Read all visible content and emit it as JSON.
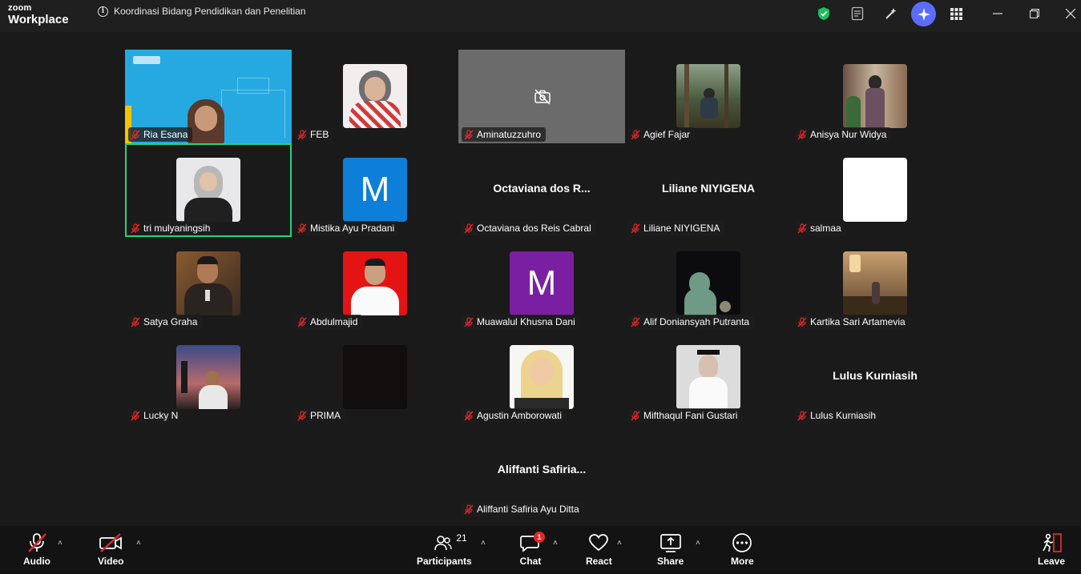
{
  "app": {
    "brand_line1": "zoom",
    "brand_line2": "Workplace"
  },
  "meeting": {
    "title": "Koordinasi Bidang Pendidikan dan Penelitian"
  },
  "participants": [
    {
      "name": "Ria Esana",
      "display_text": ""
    },
    {
      "name": "FEB",
      "display_text": ""
    },
    {
      "name": "Aminatuzzuhro",
      "display_text": ""
    },
    {
      "name": "Agief Fajar",
      "display_text": ""
    },
    {
      "name": "Anisya Nur Widya",
      "display_text": ""
    },
    {
      "name": "tri mulyaningsih",
      "display_text": ""
    },
    {
      "name": "Mistika Ayu Pradani",
      "display_text": "M"
    },
    {
      "name": "Octaviana dos Reis Cabral",
      "display_text": "Octaviana dos R..."
    },
    {
      "name": "Liliane NIYIGENA",
      "display_text": "Liliane NIYIGENA"
    },
    {
      "name": "salmaa",
      "display_text": ""
    },
    {
      "name": "Satya Graha",
      "display_text": ""
    },
    {
      "name": "Abdulmajid",
      "display_text": ""
    },
    {
      "name": "Muawalul Khusna Dani",
      "display_text": "M"
    },
    {
      "name": "Alif Doniansyah Putranta",
      "display_text": ""
    },
    {
      "name": "Kartika Sari Artamevia",
      "display_text": ""
    },
    {
      "name": "Lucky N",
      "display_text": ""
    },
    {
      "name": "PRIMA",
      "display_text": ""
    },
    {
      "name": "Agustin Amborowati",
      "display_text": ""
    },
    {
      "name": "Mifthaqul Fani Gustari",
      "display_text": ""
    },
    {
      "name": "Lulus Kurniasih",
      "display_text": "Lulus Kurniasih"
    },
    {
      "name": "Aliffanti Safiria Ayu Ditta",
      "display_text": "Aliffanti  Safiria..."
    }
  ],
  "toolbar": {
    "audio_label": "Audio",
    "video_label": "Video",
    "participants_label": "Participants",
    "participants_count": "21",
    "chat_label": "Chat",
    "chat_badge": "1",
    "react_label": "React",
    "share_label": "Share",
    "more_label": "More",
    "leave_label": "Leave"
  },
  "colors": {
    "active_speaker": "#27d17f",
    "muted_red": "#e02828",
    "security_green": "#19c15c",
    "ai_companion": "#5b6cff",
    "avatar_blue": "#0e7fd8",
    "avatar_purple": "#7b1fa2"
  },
  "icons": [
    "info-icon",
    "shield-check-icon",
    "notes-icon",
    "magic-pen-icon",
    "ai-companion-icon",
    "apps-grid-icon",
    "minimize-icon",
    "restore-icon",
    "close-icon",
    "mic-off-icon",
    "camera-off-icon",
    "people-icon",
    "chat-icon",
    "heart-icon",
    "share-screen-icon",
    "more-icon",
    "leave-icon"
  ]
}
